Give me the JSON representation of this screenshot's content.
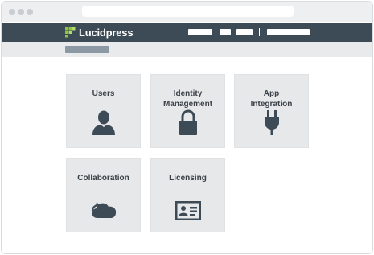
{
  "app": {
    "brand": "Lucidpress"
  },
  "tiles": [
    {
      "label": "Users",
      "icon": "user-icon"
    },
    {
      "label": "Identity\nManagement",
      "icon": "lock-icon"
    },
    {
      "label": "App\nIntegration",
      "icon": "plug-icon"
    },
    {
      "label": "Collaboration",
      "icon": "cloud-sync-icon"
    },
    {
      "label": "Licensing",
      "icon": "id-card-icon"
    }
  ],
  "colors": {
    "nav": "#3d4b56",
    "tile": "#e7e8ea",
    "icon": "#3d4b56",
    "logo_green": "#8dc63f"
  }
}
